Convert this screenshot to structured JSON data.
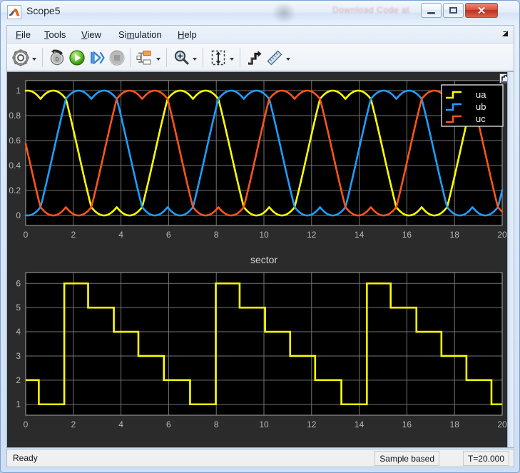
{
  "window": {
    "title": "Scope5",
    "app_icon": "matlab-scope-icon",
    "minimize_label": "—",
    "maximize_label": "□",
    "close_label": "✕"
  },
  "menu": {
    "items": [
      {
        "id": "file",
        "label": "File",
        "mnemonic": "F"
      },
      {
        "id": "tools",
        "label": "Tools",
        "mnemonic": "T"
      },
      {
        "id": "view",
        "label": "View",
        "mnemonic": "V"
      },
      {
        "id": "simulation",
        "label": "Simulation",
        "mnemonic": "S"
      },
      {
        "id": "help",
        "label": "Help",
        "mnemonic": "H"
      }
    ],
    "overflow_icon": "menu-overflow-arrow-icon"
  },
  "toolbar": {
    "buttons": [
      {
        "id": "configuration-properties",
        "icon": "gear-icon",
        "has_caret": true
      },
      {
        "id": "rewind",
        "icon": "rewind-to-start-icon",
        "has_caret": false
      },
      {
        "id": "run",
        "icon": "play-icon",
        "has_caret": false
      },
      {
        "id": "step-forward",
        "icon": "step-forward-icon",
        "has_caret": false
      },
      {
        "id": "stop",
        "icon": "stop-icon",
        "has_caret": false
      },
      {
        "id": "signal-selection",
        "icon": "signal-hierarchy-icon",
        "has_caret": true
      },
      {
        "id": "zoom",
        "icon": "magnifier-icon",
        "has_caret": true
      },
      {
        "id": "autoscale",
        "icon": "autoscale-arrows-icon",
        "has_caret": true
      },
      {
        "id": "cursor-measurements",
        "icon": "cursor-steps-icon",
        "has_caret": false
      },
      {
        "id": "annotations",
        "icon": "pencil-ruler-icon",
        "has_caret": true
      }
    ]
  },
  "plot_panel": {
    "float_button_icon": "float-expand-icon",
    "background_color": "#000000",
    "panel_color": "#2b2b2b",
    "grid_color": "#7a7a7a",
    "axis_text_color": "#b8b8b8"
  },
  "status": {
    "message": "Ready",
    "mode": "Sample based",
    "time": "T=20.000"
  },
  "chart_data": [
    {
      "id": "phase-voltages",
      "type": "line",
      "title": "",
      "xlabel": "",
      "ylabel": "",
      "xlim": [
        0,
        20
      ],
      "ylim": [
        -0.08,
        1.08
      ],
      "xticks": [
        0,
        2,
        4,
        6,
        8,
        10,
        12,
        14,
        16,
        18,
        20
      ],
      "yticks": [
        0,
        0.2,
        0.4,
        0.6,
        0.8,
        1
      ],
      "grid": true,
      "legend": {
        "position": "top-right",
        "entries": [
          {
            "label": "ua",
            "color": "#FFFF00"
          },
          {
            "label": "ub",
            "color": "#1E9EFF"
          },
          {
            "label": "uc",
            "color": "#FF5518"
          }
        ]
      },
      "waveform": "svpwm-third-harmonic-injection",
      "period": 6.4,
      "phase_offsets_deg": [
        0,
        -120,
        -240
      ],
      "phase_shift_deg": 55,
      "amplitude": 0.5,
      "offset": 0.5,
      "series": [
        {
          "name": "ua",
          "color": "#FFFF00"
        },
        {
          "name": "ub",
          "color": "#1E9EFF"
        },
        {
          "name": "uc",
          "color": "#FF5518"
        }
      ]
    },
    {
      "id": "sector",
      "type": "line",
      "title": "sector",
      "xlabel": "",
      "ylabel": "",
      "xlim": [
        0,
        20
      ],
      "ylim": [
        0.55,
        6.45
      ],
      "xticks": [
        0,
        2,
        4,
        6,
        8,
        10,
        12,
        14,
        16,
        18,
        20
      ],
      "yticks": [
        1,
        2,
        3,
        4,
        5,
        6
      ],
      "grid": true,
      "line_color": "#FFFF00",
      "step": true,
      "steps": [
        {
          "x_start": 0.0,
          "x_end": 0.55,
          "y": 2
        },
        {
          "x_start": 0.55,
          "x_end": 1.62,
          "y": 1
        },
        {
          "x_start": 1.62,
          "x_end": 2.62,
          "y": 6
        },
        {
          "x_start": 2.62,
          "x_end": 3.7,
          "y": 5
        },
        {
          "x_start": 3.7,
          "x_end": 4.73,
          "y": 4
        },
        {
          "x_start": 4.73,
          "x_end": 5.8,
          "y": 3
        },
        {
          "x_start": 5.8,
          "x_end": 6.9,
          "y": 2
        },
        {
          "x_start": 6.9,
          "x_end": 7.98,
          "y": 1
        },
        {
          "x_start": 7.98,
          "x_end": 8.98,
          "y": 6
        },
        {
          "x_start": 8.98,
          "x_end": 10.05,
          "y": 5
        },
        {
          "x_start": 10.05,
          "x_end": 11.1,
          "y": 4
        },
        {
          "x_start": 11.1,
          "x_end": 12.15,
          "y": 3
        },
        {
          "x_start": 12.15,
          "x_end": 13.25,
          "y": 2
        },
        {
          "x_start": 13.25,
          "x_end": 14.32,
          "y": 1
        },
        {
          "x_start": 14.32,
          "x_end": 15.32,
          "y": 6
        },
        {
          "x_start": 15.32,
          "x_end": 16.4,
          "y": 5
        },
        {
          "x_start": 16.4,
          "x_end": 17.45,
          "y": 4
        },
        {
          "x_start": 17.45,
          "x_end": 18.5,
          "y": 3
        },
        {
          "x_start": 18.5,
          "x_end": 19.55,
          "y": 2
        },
        {
          "x_start": 19.55,
          "x_end": 20.0,
          "y": 1
        }
      ]
    }
  ]
}
